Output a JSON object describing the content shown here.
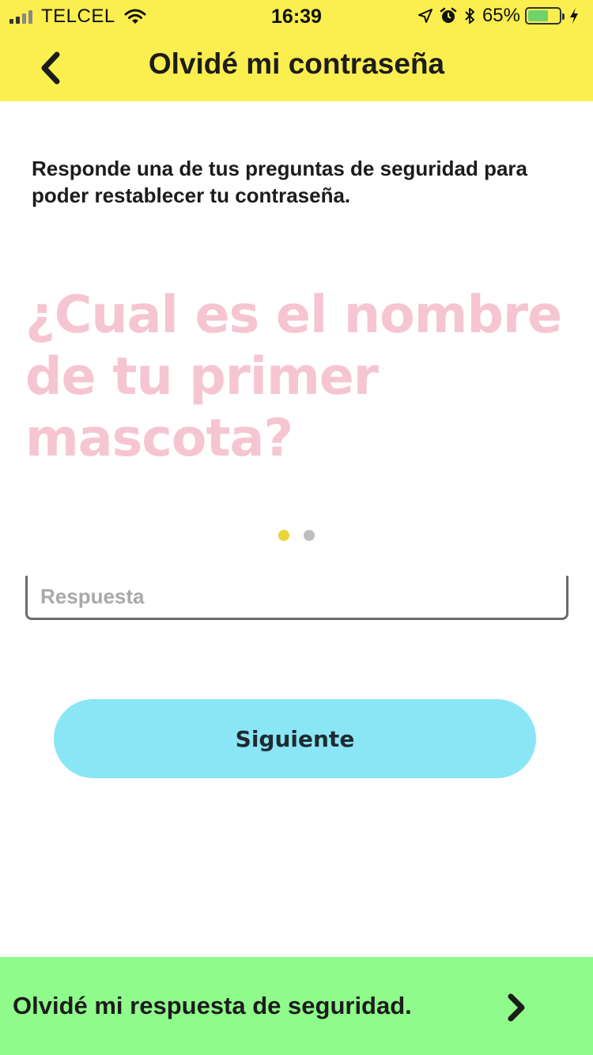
{
  "status_bar": {
    "carrier": "TELCEL",
    "time": "16:39",
    "battery_percent": "65%",
    "battery_level": 0.65,
    "icons": [
      "signal-icon",
      "wifi-icon",
      "location-icon",
      "alarm-icon",
      "bluetooth-icon",
      "battery-icon",
      "charging-icon"
    ]
  },
  "header": {
    "back_icon": "chevron-left-icon",
    "title": "Olvidé mi contraseña"
  },
  "main": {
    "instructions": "Responde una de tus preguntas de seguridad para poder restablecer tu contraseña.",
    "question": "¿Cual es el nombre de tu primer mascota?",
    "pager": {
      "count": 2,
      "active_index": 0
    },
    "answer": {
      "value": "",
      "placeholder": "Respuesta"
    },
    "next_button": "Siguiente"
  },
  "footer": {
    "label": "Olvidé mi respuesta de seguridad.",
    "icon": "chevron-right-icon"
  },
  "colors": {
    "header_bg": "#fbee4f",
    "question_text": "#f6c5d2",
    "dot_active": "#e8d53a",
    "dot_inactive": "#bdbdbd",
    "button_bg": "#8ae6f5",
    "footer_bg": "#8ffb8a"
  }
}
